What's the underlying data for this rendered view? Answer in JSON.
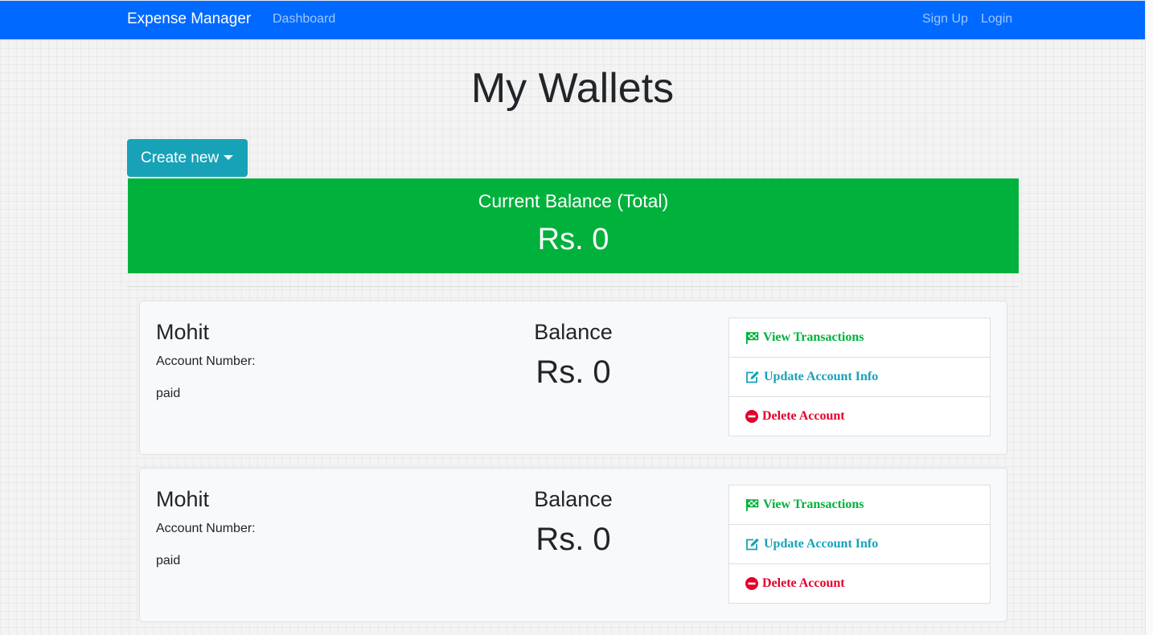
{
  "navbar": {
    "brand": "Expense Manager",
    "links": {
      "dashboard": "Dashboard",
      "signup": "Sign Up",
      "login": "Login"
    }
  },
  "page": {
    "title": "My Wallets",
    "create_button": "Create new"
  },
  "total": {
    "label": "Current Balance (Total)",
    "value": "Rs. 0"
  },
  "wallets": [
    {
      "name": "Mohit",
      "account_number_label": "Account Number:",
      "type": "paid",
      "balance_label": "Balance",
      "balance": "Rs. 0",
      "actions": {
        "view": "View Transactions",
        "update": "Update Account Info",
        "delete": "Delete Account"
      }
    },
    {
      "name": "Mohit",
      "account_number_label": "Account Number:",
      "type": "paid",
      "balance_label": "Balance",
      "balance": "Rs. 0",
      "actions": {
        "view": "View Transactions",
        "update": "Update Account Info",
        "delete": "Delete Account"
      }
    }
  ],
  "icons": {
    "view": "flag-checkered-icon",
    "update": "edit-icon",
    "delete": "minus-circle-icon",
    "dropdown": "caret-down-icon"
  },
  "colors": {
    "navbar": "#0069ff",
    "primary_teal": "#17a2b8",
    "success_green": "#00b13c",
    "danger_red": "#e3002b"
  }
}
